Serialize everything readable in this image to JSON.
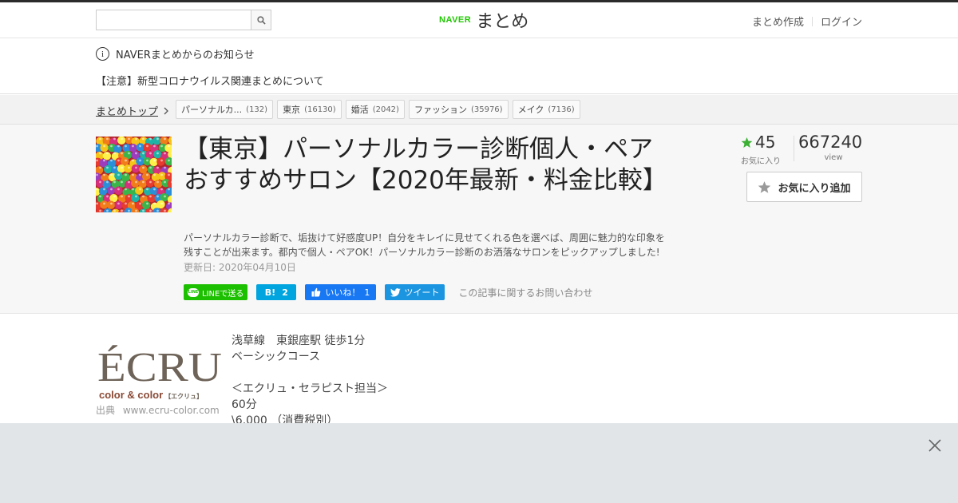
{
  "header": {
    "search_placeholder": "",
    "logo_brand": "NAVER",
    "logo_name": "まとめ",
    "links": [
      "まとめ作成",
      "ログイン"
    ]
  },
  "notice": {
    "heading": "NAVERまとめからのお知らせ",
    "item": "【注意】新型コロナウイルス関連まとめについて"
  },
  "breadcrumb": {
    "top_label": "まとめトップ",
    "tags": [
      {
        "label": "パーソナルカ...",
        "count": "(132)"
      },
      {
        "label": "東京",
        "count": "(16130)"
      },
      {
        "label": "婚活",
        "count": "(2042)"
      },
      {
        "label": "ファッション",
        "count": "(35976)"
      },
      {
        "label": "メイク",
        "count": "(7136)"
      }
    ]
  },
  "article": {
    "title": "【東京】パーソナルカラー診断個人・ペアおすすめサロン【2020年最新・料金比較】",
    "description": "パーソナルカラー診断で、垢抜けて好感度UP！自分をキレイに見せてくれる色を選べば、周囲に魅力的な印象を残すことが出来ます。都内で個人・ペアOK！パーソナルカラー診断のお洒落なサロンをピックアップしました!",
    "updated": "更新日: 2020年04月10日",
    "favorites": "45",
    "favorites_label": "お気に入り",
    "views": "667240",
    "views_label": "view",
    "fav_button": "お気に入り追加"
  },
  "share": {
    "line": "LINEで送る",
    "line_logo": "LINE",
    "hatena_logo": "B!",
    "hatena_count": "2",
    "fb_label": "いいね！",
    "fb_count": "1",
    "tweet": "ツイート",
    "contact": "この記事に関するお問い合わせ"
  },
  "content": {
    "logo_text": "ÉCRU",
    "logo_sub": "color & color",
    "logo_sub_jp": "【エクリュ】",
    "source_label": "出典",
    "source_domain": "www.ecru-color.com",
    "lines": [
      "浅草線　東銀座駅 徒歩1分",
      "ベーシックコース",
      "",
      "＜エクリュ・セラピスト担当＞",
      "60分",
      "\\6,000 （消費税別）"
    ]
  },
  "colors": {
    "naver_green": "#1ec800",
    "line_green": "#1dc000",
    "hatena_blue": "#00a4de",
    "facebook_blue": "#1877f2",
    "twitter_blue": "#1b95e0",
    "star_green": "#3cb034",
    "ad_bg": "#e1e5e8"
  }
}
